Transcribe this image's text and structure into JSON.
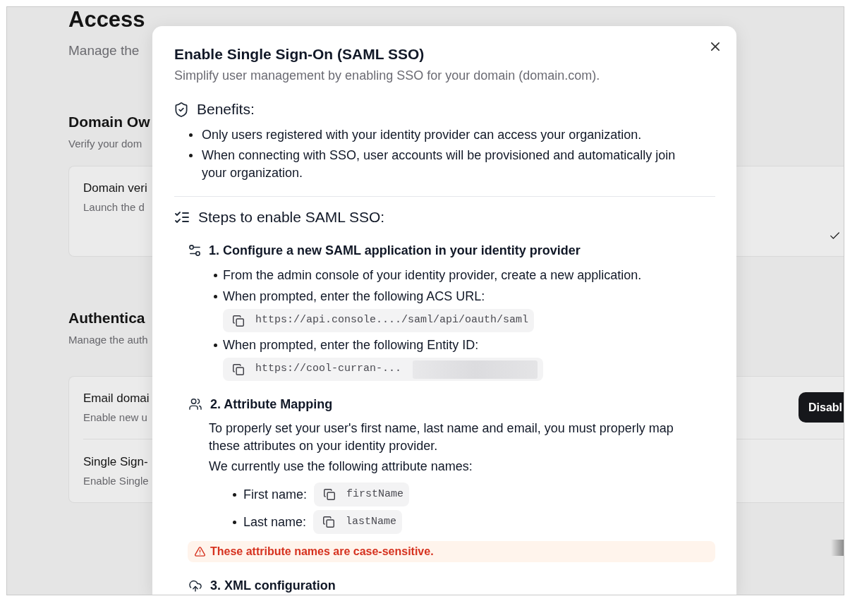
{
  "page": {
    "title": "Access",
    "subtitle": "Manage the",
    "sections": [
      {
        "heading": "Domain Ow",
        "description": "Verify your dom",
        "card_rows": [
          {
            "kind": "check",
            "title": "Domain veri",
            "description": "Launch the d"
          }
        ]
      },
      {
        "heading": "Authentica",
        "description": "Manage the auth",
        "card_rows": [
          {
            "kind": "button",
            "title": "Email domai",
            "description": "Enable new u",
            "button": "Disabl"
          },
          {
            "kind": "plain",
            "title": "Single Sign-",
            "description": "Enable Single"
          }
        ]
      }
    ]
  },
  "dialog": {
    "title": "Enable Single Sign-On (SAML SSO)",
    "subtitle": "Simplify user management by enabling SSO for your domain (domain.com).",
    "benefits": {
      "heading": "Benefits:",
      "items": [
        "Only users registered with your identity provider can access your organization.",
        "When connecting with SSO, user accounts will be provisioned and automatically join your organization."
      ]
    },
    "steps_section": {
      "heading": "Steps to enable SAML SSO:",
      "steps": [
        {
          "kind": "configure",
          "title": "1. Configure a new SAML application in your identity provider",
          "items": [
            {
              "text": "From the admin console of your identity provider, create a new application."
            },
            {
              "text": "When prompted, enter the following ACS URL:",
              "code": "https://api.console..../saml/api/oauth/saml",
              "redacted": false
            },
            {
              "text": "When prompted, enter the following Entity ID:",
              "code": "https://cool-curran-...",
              "redacted": true
            }
          ]
        },
        {
          "kind": "attribute_mapping",
          "title": "2. Attribute Mapping",
          "paragraphs": [
            "To properly set your user's first name, last name and email, you must properly map these attributes on your identity provider.",
            "We currently use the following attribute names:"
          ],
          "attributes": [
            {
              "label": "First name:",
              "code": "firstName"
            },
            {
              "label": "Last name:",
              "code": "lastName"
            }
          ],
          "warning": "These attribute names are case-sensitive."
        },
        {
          "kind": "xml_configuration",
          "title": "3. XML configuration"
        }
      ]
    }
  }
}
